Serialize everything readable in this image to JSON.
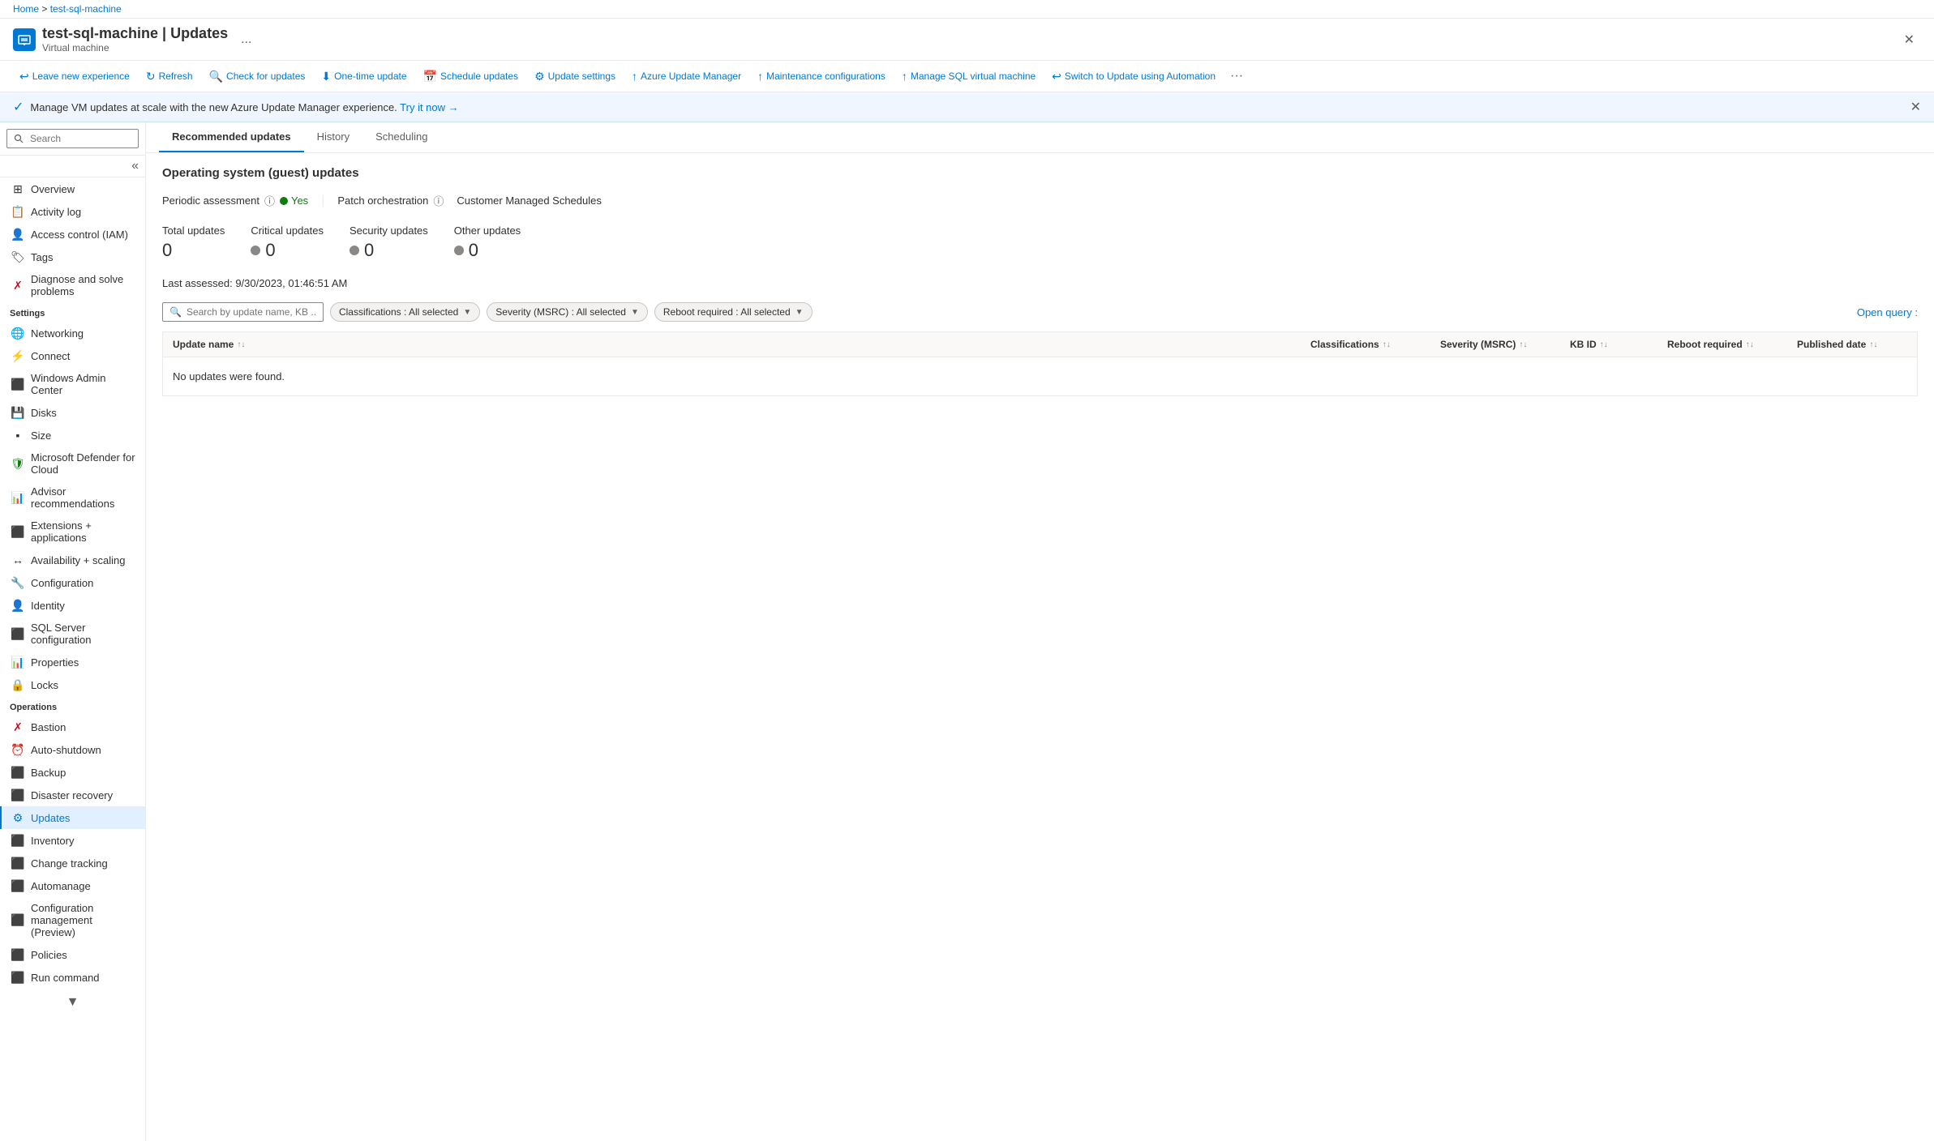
{
  "breadcrumb": {
    "home": "Home",
    "separator1": ">",
    "resource": "test-sql-machine"
  },
  "pageHeader": {
    "icon": "⚙",
    "title": "test-sql-machine | Updates",
    "subtitle": "Virtual machine",
    "moreLabel": "...",
    "closeLabel": "✕"
  },
  "toolbar": {
    "buttons": [
      {
        "id": "leave-new-experience",
        "icon": "↩",
        "label": "Leave new experience"
      },
      {
        "id": "refresh",
        "icon": "↻",
        "label": "Refresh"
      },
      {
        "id": "check-for-updates",
        "icon": "🔍",
        "label": "Check for updates"
      },
      {
        "id": "one-time-update",
        "icon": "⬇",
        "label": "One-time update"
      },
      {
        "id": "schedule-updates",
        "icon": "📅",
        "label": "Schedule updates"
      },
      {
        "id": "update-settings",
        "icon": "⚙",
        "label": "Update settings"
      },
      {
        "id": "azure-update-manager",
        "icon": "↑",
        "label": "Azure Update Manager"
      },
      {
        "id": "maintenance-configurations",
        "icon": "↑",
        "label": "Maintenance configurations"
      },
      {
        "id": "manage-sql",
        "icon": "↑",
        "label": "Manage SQL virtual machine"
      },
      {
        "id": "switch-to-update",
        "icon": "↩",
        "label": "Switch to Update using Automation"
      }
    ],
    "moreLabel": "..."
  },
  "infoBanner": {
    "icon": "✓",
    "text": "Manage VM updates at scale with the new Azure Update Manager experience. Try it now →",
    "linkText": "Try it now →",
    "closeLabel": "✕"
  },
  "sidebar": {
    "searchPlaceholder": "Search",
    "collapseIcon": "«",
    "sections": [
      {
        "id": "general",
        "label": null,
        "items": [
          {
            "id": "overview",
            "icon": "⊞",
            "label": "Overview"
          },
          {
            "id": "activity-log",
            "icon": "📋",
            "label": "Activity log"
          },
          {
            "id": "access-control",
            "icon": "👤",
            "label": "Access control (IAM)"
          },
          {
            "id": "tags",
            "icon": "🏷",
            "label": "Tags"
          },
          {
            "id": "diagnose",
            "icon": "✗",
            "label": "Diagnose and solve problems"
          }
        ]
      },
      {
        "id": "settings",
        "label": "Settings",
        "items": [
          {
            "id": "networking",
            "icon": "🌐",
            "label": "Networking"
          },
          {
            "id": "connect",
            "icon": "⚡",
            "label": "Connect"
          },
          {
            "id": "windows-admin-center",
            "icon": "⬛",
            "label": "Windows Admin Center"
          },
          {
            "id": "disks",
            "icon": "💾",
            "label": "Disks"
          },
          {
            "id": "size",
            "icon": "▪",
            "label": "Size"
          },
          {
            "id": "microsoft-defender",
            "icon": "🛡",
            "label": "Microsoft Defender for Cloud"
          },
          {
            "id": "advisor-recommendations",
            "icon": "📊",
            "label": "Advisor recommendations"
          },
          {
            "id": "extensions",
            "icon": "⬛",
            "label": "Extensions + applications"
          },
          {
            "id": "availability-scaling",
            "icon": "↔",
            "label": "Availability + scaling"
          },
          {
            "id": "configuration",
            "icon": "🔧",
            "label": "Configuration"
          },
          {
            "id": "identity",
            "icon": "👤",
            "label": "Identity"
          },
          {
            "id": "sql-server-configuration",
            "icon": "⬛",
            "label": "SQL Server configuration"
          },
          {
            "id": "properties",
            "icon": "📊",
            "label": "Properties"
          },
          {
            "id": "locks",
            "icon": "🔒",
            "label": "Locks"
          }
        ]
      },
      {
        "id": "operations",
        "label": "Operations",
        "items": [
          {
            "id": "bastion",
            "icon": "✗",
            "label": "Bastion"
          },
          {
            "id": "auto-shutdown",
            "icon": "⏰",
            "label": "Auto-shutdown"
          },
          {
            "id": "backup",
            "icon": "⬛",
            "label": "Backup"
          },
          {
            "id": "disaster-recovery",
            "icon": "⬛",
            "label": "Disaster recovery"
          },
          {
            "id": "updates",
            "icon": "⚙",
            "label": "Updates",
            "active": true
          },
          {
            "id": "inventory",
            "icon": "⬛",
            "label": "Inventory"
          },
          {
            "id": "change-tracking",
            "icon": "⬛",
            "label": "Change tracking"
          },
          {
            "id": "automanage",
            "icon": "⬛",
            "label": "Automanage"
          },
          {
            "id": "configuration-management",
            "icon": "⬛",
            "label": "Configuration management (Preview)"
          },
          {
            "id": "policies",
            "icon": "⬛",
            "label": "Policies"
          },
          {
            "id": "run-command",
            "icon": "⬛",
            "label": "Run command"
          }
        ]
      }
    ]
  },
  "tabs": [
    {
      "id": "recommended-updates",
      "label": "Recommended updates",
      "active": true
    },
    {
      "id": "history",
      "label": "History",
      "active": false
    },
    {
      "id": "scheduling",
      "label": "Scheduling",
      "active": false
    }
  ],
  "content": {
    "sectionTitle": "Operating system (guest) updates",
    "periodicAssessment": {
      "label": "Periodic assessment",
      "infoIcon": "ⓘ",
      "value": "Yes",
      "statusDot": "green"
    },
    "divider": "|",
    "patchOrchestration": {
      "label": "Patch orchestration",
      "infoIcon": "ⓘ"
    },
    "customerManagedSchedules": "Customer Managed Schedules",
    "stats": [
      {
        "id": "total-updates",
        "label": "Total updates",
        "value": "0",
        "dot": false
      },
      {
        "id": "critical-updates",
        "label": "Critical updates",
        "value": "0",
        "dot": true
      },
      {
        "id": "security-updates",
        "label": "Security updates",
        "value": "0",
        "dot": true
      },
      {
        "id": "other-updates",
        "label": "Other updates",
        "value": "0",
        "dot": true
      }
    ],
    "lastAssessed": "Last assessed: 9/30/2023, 01:46:51 AM",
    "filters": {
      "searchPlaceholder": "Search by update name, KB ...",
      "tags": [
        {
          "id": "classifications-filter",
          "label": "Classifications : All selected"
        },
        {
          "id": "severity-filter",
          "label": "Severity (MSRC) : All selected"
        },
        {
          "id": "reboot-filter",
          "label": "Reboot required : All selected"
        }
      ]
    },
    "openQueryLink": "Open query :",
    "table": {
      "columns": [
        {
          "id": "update-name",
          "label": "Update name"
        },
        {
          "id": "classifications",
          "label": "Classifications"
        },
        {
          "id": "severity-msrc",
          "label": "Severity (MSRC)"
        },
        {
          "id": "kb-id",
          "label": "KB ID"
        },
        {
          "id": "reboot-required",
          "label": "Reboot required"
        },
        {
          "id": "published-date",
          "label": "Published date"
        }
      ],
      "emptyMessage": "No updates were found."
    }
  }
}
